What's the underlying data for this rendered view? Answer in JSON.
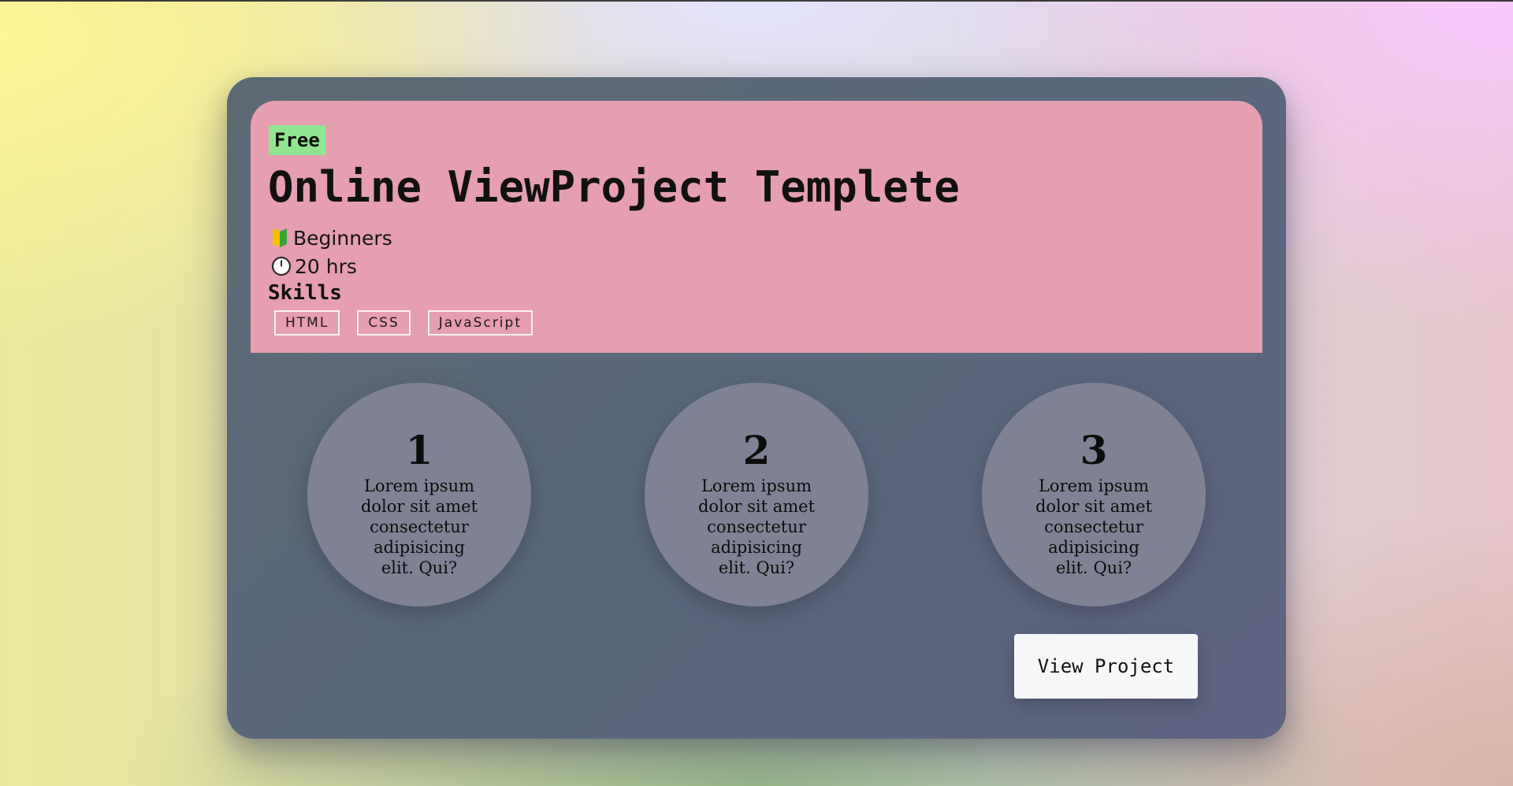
{
  "card": {
    "badge": "Free",
    "title": "Online ViewProject Templete",
    "level": "Beginners",
    "duration": "20 hrs",
    "level_icon": "beginner-leaf-icon",
    "duration_icon": "clock-icon",
    "skills_title": "Skills",
    "skills": [
      "HTML",
      "CSS",
      "JavaScript"
    ],
    "steps": [
      {
        "number": "1",
        "text": "Lorem ipsum dolor sit amet consectetur adipisicing elit. Qui?"
      },
      {
        "number": "2",
        "text": "Lorem ipsum dolor sit amet consectetur adipisicing elit. Qui?"
      },
      {
        "number": "3",
        "text": "Lorem ipsum dolor sit amet consectetur adipisicing elit. Qui?"
      }
    ],
    "button_label": "View Project"
  },
  "colors": {
    "header_bg": "#e59fb0",
    "badge_bg": "#90e690",
    "card_bg": "#5b6878",
    "circle_bg": "#7f8294",
    "button_bg": "#f6f7f9"
  }
}
